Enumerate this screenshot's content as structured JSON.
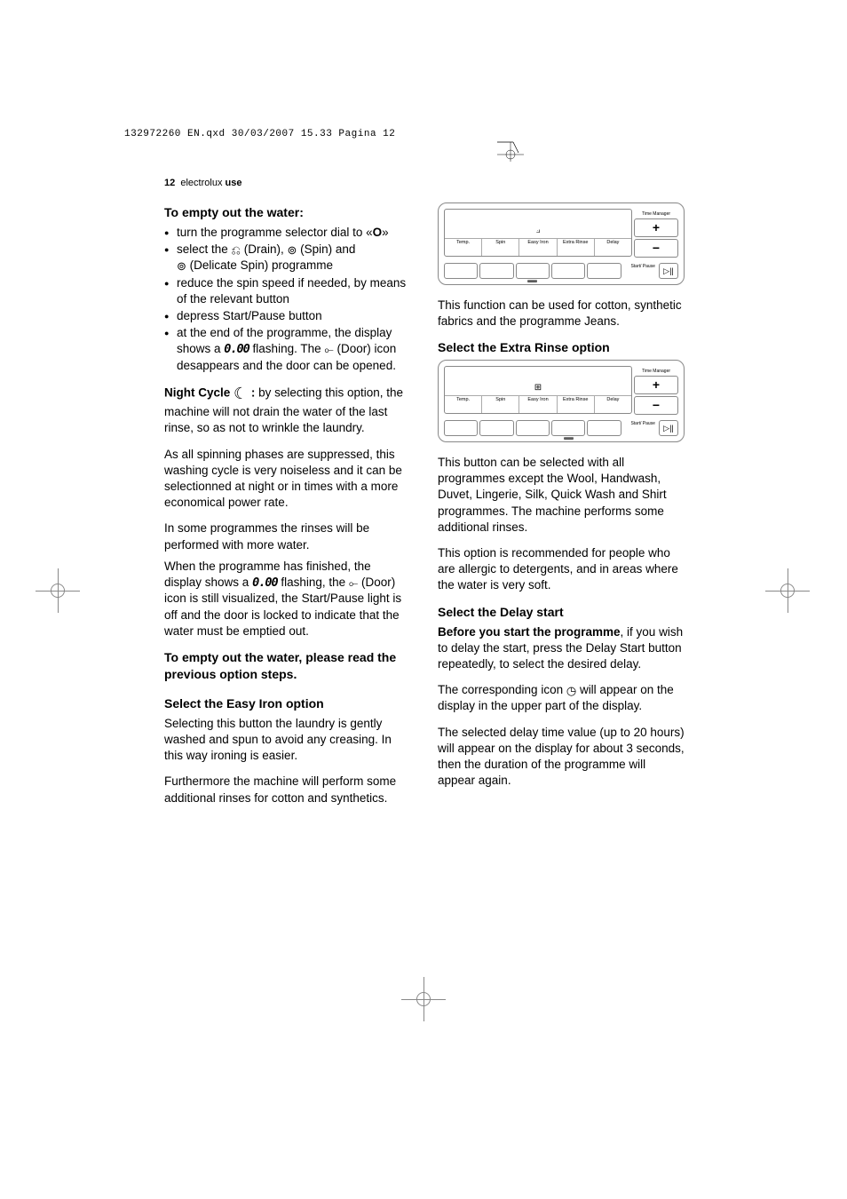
{
  "header": {
    "print_line": "132972260 EN.qxd  30/03/2007  15.33  Pagina  12",
    "page_num": "12",
    "brand": "electrolux",
    "section": "use"
  },
  "left": {
    "h1": "To empty out the water:",
    "bullets": [
      "turn the programme selector dial to « O »",
      "select the ⎵ (Drain), ⊚ (Spin) and ⊚ (Delicate Spin) programme",
      "reduce the spin speed if needed, by means of the relevant button",
      "depress Start/Pause button",
      "at the end of the programme, the display shows a 0.00 flashing. The ⟜ (Door) icon desappears and the door can be opened."
    ],
    "bullet_labels": {
      "b1_pre": "turn the programme selector dial to «",
      "b1_o": "O",
      "b1_post": "»",
      "b2_pre": "select the ",
      "b2_drain": " (Drain), ",
      "b2_spin": " (Spin) and",
      "b2_delicate": " (Delicate Spin) programme",
      "b3": "reduce the spin speed if needed, by means of the relevant button",
      "b4": "depress Start/Pause button",
      "b5_pre": "at the end of the programme, the display shows a ",
      "b5_zero": "0.00",
      "b5_mid": " flashing. The ",
      "b5_post": " (Door) icon desappears and the door can be opened."
    },
    "night_label": "Night Cycle ",
    "night_colon": " :",
    "night_rest": " by selecting this option, the machine will not drain the water of the last rinse, so as not to wrinkle the laundry.",
    "p_spin": "As all spinning phases are suppressed, this washing cycle is very noiseless and it can be selectionned at night or in times with a more economical power rate.",
    "p_rinse": "In some programmes the rinses will be performed with more water.",
    "p_finish_pre": "When the programme has finished, the display shows a ",
    "p_finish_zero": "0.00",
    "p_finish_mid": " flashing, the ",
    "p_finish_post": " (Door) icon is still visualized, the Start/Pause light is off and the door is locked to indicate that the water must be emptied out.",
    "h2": "To empty out the water, please read the previous option steps.",
    "h3": "Select the Easy Iron option",
    "p_easy1": "Selecting this button the laundry is gently washed and spun to avoid any creasing. In this way ironing is easier.",
    "p_easy2": "Furthermore the machine will perform some additional rinses for cotton and synthetics."
  },
  "right": {
    "p_func": "This function can be used for cotton, synthetic fabrics and the programme Jeans.",
    "h1": "Select the Extra Rinse option",
    "p_extra1": "This button can be selected with all programmes except the Wool, Handwash, Duvet, Lingerie, Silk, Quick Wash and Shirt programmes. The machine performs some additional rinses.",
    "p_extra2": "This option is recommended for people who are allergic to detergents, and in areas where the water is very soft.",
    "h2": "Select the Delay start",
    "p_delay1_bold": "Before you start the programme",
    "p_delay1_rest": ", if you wish to delay the start, press the Delay Start button repeatedly, to select the desired delay.",
    "p_delay2_pre": "The corresponding icon ",
    "p_delay2_post": " will appear on the display in the upper part of the display.",
    "p_delay3": "The selected delay time value (up to 20 hours) will appear on the display for about 3 seconds, then the duration of the programme will appear again."
  },
  "panel": {
    "time_manager": "Time Manager",
    "plus": "+",
    "minus": "−",
    "labels": [
      "Temp.",
      "Spin",
      "Easy Iron",
      "Extra Rinse",
      "Delay"
    ],
    "start_pause": "Start/ Pause",
    "iron_icon": "⟓",
    "rinse_icon": "⊞",
    "play_pause": "▷||"
  }
}
